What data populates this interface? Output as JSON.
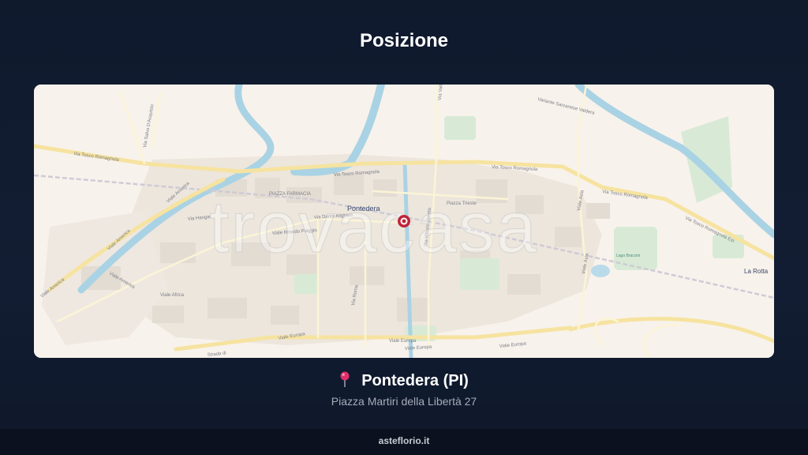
{
  "title": "Posizione",
  "map": {
    "watermark": "trovacasa",
    "city_label": "Pontedera",
    "place_labels": {
      "la_rotta": "La Rotta",
      "piazza_marconi": "PIAZZA FARMACIA",
      "laghetto": "Lago Braccini",
      "piazza_trieste": "Piazza Trieste"
    },
    "street_labels": {
      "tosco_romagnola_w": "Via Tosco Romagnola",
      "tosco_romagnola_c": "Via Tosco Romagnola",
      "tosco_romagnola_e": "Via Tosco Romagnola",
      "tosco_romagnola_e2": "Via Tosco Romagnola",
      "tosco_romagnola_est": "Via Tosco Romagnola Est",
      "viale_america_1": "Viale America",
      "viale_america_2": "Viale America",
      "viale_america_3": "Viale America",
      "viale_europa_1": "Viale Europa",
      "viale_europa_2": "Viale Europa",
      "viale_europa_3": "Viale Europa",
      "viale_europa_4": "Viale Europa",
      "viale_asia_1": "Viale Asia",
      "viale_asia_2": "Viale Asia",
      "viale_africa": "Viale Africa",
      "via_hangar": "Via Hangar",
      "via_rinaldo_piaggio": "Viale Rinaldo Piaggio",
      "via_dante": "Via Dante Alighieri",
      "via_valdera": "Via Valdera",
      "via_roma": "Via Roma",
      "via_salvo": "Via Salvo D'Acquisto",
      "strada": "Strada di",
      "variante": "Variante Sarzanese Valdera",
      "via_vittorio_veneto": "Via Vittorio Veneto"
    }
  },
  "location": {
    "name": "Pontedera (PI)",
    "address": "Piazza Martiri della Libertà 27"
  },
  "footer": {
    "site": "asteflorio.it"
  },
  "colors": {
    "background": "#111b30",
    "map_land": "#f8f2ec",
    "river": "#a9d3e4",
    "road_major": "#f6e3a0",
    "marker": "#c0243a"
  },
  "icons": {
    "location_pin": "round-pushpin-icon",
    "map_marker": "map-marker-icon"
  }
}
